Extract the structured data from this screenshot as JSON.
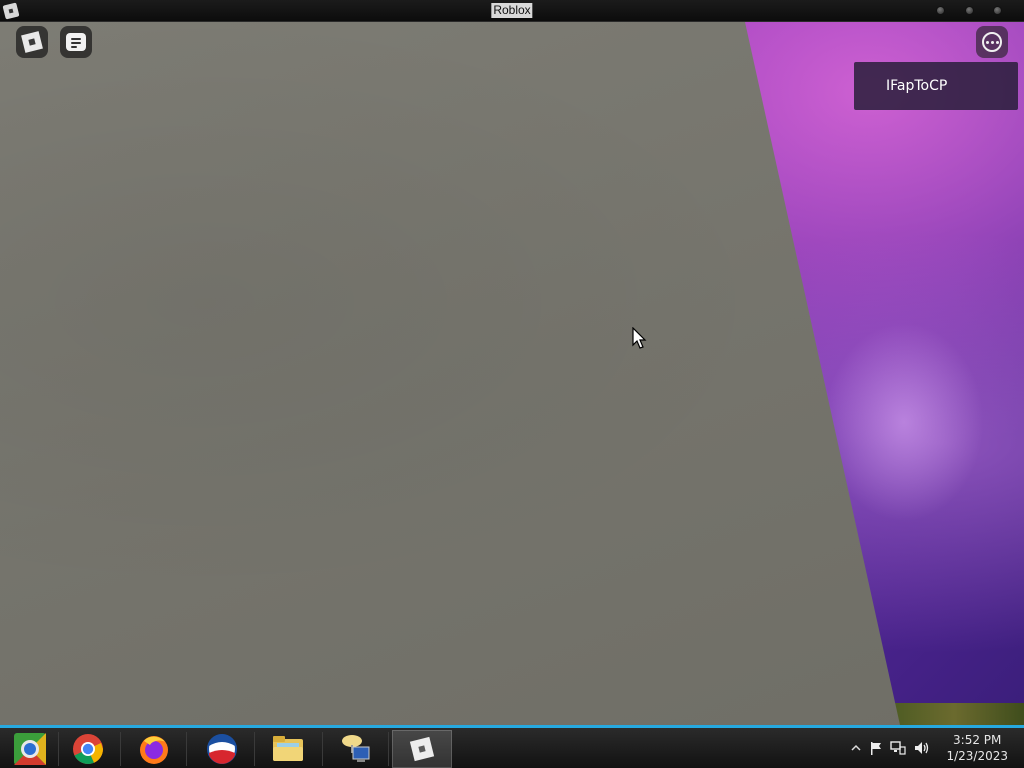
{
  "window": {
    "title": "Roblox"
  },
  "game": {
    "player_list": {
      "players": [
        "IFapToCP"
      ]
    },
    "buttons": {
      "menu_icon": "roblox-logo-icon",
      "chat_icon": "chat-icon",
      "more_icon": "more-options-icon"
    }
  },
  "taskbar": {
    "accent_color": "#26a9e0",
    "apps": [
      {
        "name": "Chromium",
        "icon": "chromium-icon"
      },
      {
        "name": "Google Chrome",
        "icon": "chrome-icon"
      },
      {
        "name": "Firefox",
        "icon": "firefox-icon"
      },
      {
        "name": "Pepsi",
        "icon": "pepsi-icon"
      },
      {
        "name": "File Explorer",
        "icon": "folder-icon"
      },
      {
        "name": "Network",
        "icon": "network-computer-icon"
      },
      {
        "name": "Roblox",
        "icon": "roblox-icon",
        "active": true
      }
    ],
    "tray": {
      "icons": [
        "show-hidden-arrow-icon",
        "action-center-flag-icon",
        "network-icon",
        "volume-icon"
      ],
      "time": "3:52 PM",
      "date": "1/23/2023"
    }
  }
}
